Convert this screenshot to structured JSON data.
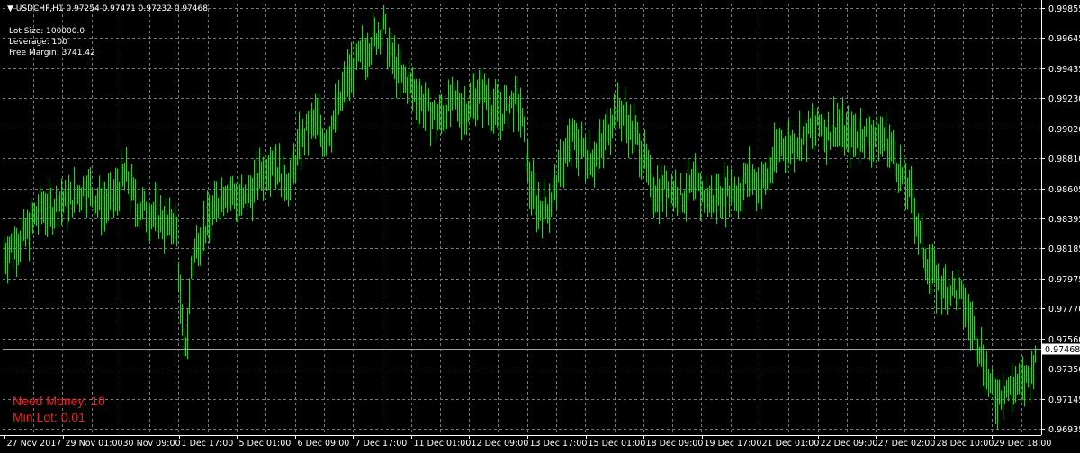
{
  "header": {
    "symbol": "USDCHF,H1",
    "ohlc": "0.97254 0.97471 0.97232 0.97468"
  },
  "account": {
    "lot_size": "Lot Size: 100000.0",
    "leverage": "Leverage: 100",
    "free_margin": "Free Margin: 3741.42"
  },
  "warnings": {
    "need_money": "Need Money: 10",
    "min_lot": "Min Lot: 0.01"
  },
  "colors": {
    "background": "#000000",
    "candle": "#3fbf3f",
    "grid": "#6e7a7a",
    "axis_text": "#ffffff",
    "warning": "#ff1a1a"
  },
  "chart_data": {
    "type": "bar",
    "symbol": "USDCHF",
    "timeframe": "H1",
    "grid": true,
    "ylim": [
      0.96905,
      0.99875
    ],
    "y_ticks": [
      "0.99855",
      "0.99645",
      "0.99435",
      "0.99230",
      "0.99020",
      "0.98810",
      "0.98605",
      "0.98395",
      "0.98185",
      "0.97975",
      "0.97770",
      "0.97560",
      "0.97350",
      "0.97145",
      "0.96935"
    ],
    "current_price": "0.97468",
    "x_ticks": [
      "27 Nov 2017",
      "29 Nov 01:00",
      "30 Nov 09:00",
      "1 Dec 17:00",
      "5 Dec 01:00",
      "6 Dec 09:00",
      "7 Dec 17:00",
      "11 Dec 01:00",
      "12 Dec 09:00",
      "13 Dec 17:00",
      "15 Dec 01:00",
      "18 Dec 09:00",
      "19 Dec 17:00",
      "21 Dec 01:00",
      "22 Dec 09:00",
      "27 Dec 02:00",
      "28 Dec 10:00",
      "29 Dec 18:00"
    ],
    "series": [
      {
        "values": [
          [
            0,
            0.981
          ],
          [
            10,
            0.9818
          ],
          [
            18,
            0.9822
          ],
          [
            28,
            0.9828
          ],
          [
            38,
            0.984
          ],
          [
            48,
            0.9848
          ],
          [
            55,
            0.9842
          ],
          [
            65,
            0.9852
          ],
          [
            75,
            0.985
          ],
          [
            86,
            0.9856
          ],
          [
            96,
            0.9862
          ],
          [
            106,
            0.9852
          ],
          [
            116,
            0.9848
          ],
          [
            126,
            0.9852
          ],
          [
            134,
            0.9865
          ],
          [
            140,
            0.987
          ],
          [
            146,
            0.9858
          ],
          [
            152,
            0.9848
          ],
          [
            160,
            0.9845
          ],
          [
            170,
            0.9842
          ],
          [
            180,
            0.9838
          ],
          [
            187,
            0.9832
          ],
          [
            192,
            0.9838
          ],
          [
            196,
            0.9828
          ],
          [
            200,
            0.9778
          ],
          [
            204,
            0.9745
          ],
          [
            208,
            0.976
          ],
          [
            212,
            0.9805
          ],
          [
            220,
            0.9825
          ],
          [
            230,
            0.9835
          ],
          [
            240,
            0.9848
          ],
          [
            250,
            0.986
          ],
          [
            260,
            0.9855
          ],
          [
            270,
            0.985
          ],
          [
            282,
            0.9862
          ],
          [
            292,
            0.9872
          ],
          [
            302,
            0.9882
          ],
          [
            312,
            0.987
          ],
          [
            322,
            0.9865
          ],
          [
            332,
            0.989
          ],
          [
            342,
            0.9902
          ],
          [
            352,
            0.9908
          ],
          [
            360,
            0.9895
          ],
          [
            368,
            0.9905
          ],
          [
            376,
            0.9918
          ],
          [
            384,
            0.9935
          ],
          [
            392,
            0.9945
          ],
          [
            400,
            0.9952
          ],
          [
            410,
            0.9962
          ],
          [
            418,
            0.9968
          ],
          [
            426,
            0.9975
          ],
          [
            430,
            0.9962
          ],
          [
            436,
            0.9952
          ],
          [
            444,
            0.9938
          ],
          [
            452,
            0.9935
          ],
          [
            460,
            0.9928
          ],
          [
            470,
            0.992
          ],
          [
            480,
            0.9912
          ],
          [
            488,
            0.991
          ],
          [
            496,
            0.9918
          ],
          [
            506,
            0.992
          ],
          [
            516,
            0.9915
          ],
          [
            524,
            0.9922
          ],
          [
            532,
            0.9928
          ],
          [
            540,
            0.9925
          ],
          [
            548,
            0.9915
          ],
          [
            556,
            0.9912
          ],
          [
            564,
            0.9918
          ],
          [
            572,
            0.9922
          ],
          [
            578,
            0.9915
          ],
          [
            582,
            0.9895
          ],
          [
            588,
            0.9865
          ],
          [
            596,
            0.9848
          ],
          [
            604,
            0.9845
          ],
          [
            612,
            0.9852
          ],
          [
            620,
            0.9868
          ],
          [
            628,
            0.9885
          ],
          [
            636,
            0.9895
          ],
          [
            644,
            0.989
          ],
          [
            652,
            0.9885
          ],
          [
            660,
            0.9882
          ],
          [
            668,
            0.9888
          ],
          [
            676,
            0.9905
          ],
          [
            684,
            0.9915
          ],
          [
            692,
            0.9912
          ],
          [
            700,
            0.9902
          ],
          [
            708,
            0.9895
          ],
          [
            716,
            0.988
          ],
          [
            722,
            0.9862
          ],
          [
            730,
            0.9858
          ],
          [
            740,
            0.9862
          ],
          [
            750,
            0.9858
          ],
          [
            758,
            0.9855
          ],
          [
            766,
            0.986
          ],
          [
            774,
            0.9862
          ],
          [
            782,
            0.9855
          ],
          [
            790,
            0.9852
          ],
          [
            798,
            0.9856
          ],
          [
            806,
            0.9858
          ],
          [
            814,
            0.986
          ],
          [
            820,
            0.9855
          ],
          [
            826,
            0.9865
          ],
          [
            834,
            0.9868
          ],
          [
            842,
            0.9862
          ],
          [
            850,
            0.9865
          ],
          [
            858,
            0.9878
          ],
          [
            866,
            0.9892
          ],
          [
            874,
            0.989
          ],
          [
            882,
            0.9892
          ],
          [
            890,
            0.9895
          ],
          [
            898,
            0.99
          ],
          [
            906,
            0.9902
          ],
          [
            912,
            0.9905
          ],
          [
            918,
            0.9898
          ],
          [
            924,
            0.9902
          ],
          [
            930,
            0.9905
          ],
          [
            936,
            0.99
          ],
          [
            944,
            0.9895
          ],
          [
            952,
            0.9898
          ],
          [
            960,
            0.99
          ],
          [
            968,
            0.9896
          ],
          [
            976,
            0.9898
          ],
          [
            984,
            0.9895
          ],
          [
            990,
            0.9888
          ],
          [
            996,
            0.9878
          ],
          [
            1002,
            0.9868
          ],
          [
            1008,
            0.986
          ],
          [
            1014,
            0.985
          ],
          [
            1020,
            0.983
          ],
          [
            1026,
            0.9815
          ],
          [
            1032,
            0.9805
          ],
          [
            1040,
            0.9795
          ],
          [
            1048,
            0.9788
          ],
          [
            1056,
            0.979
          ],
          [
            1064,
            0.9785
          ],
          [
            1072,
            0.9778
          ],
          [
            1078,
            0.9765
          ],
          [
            1084,
            0.9755
          ],
          [
            1090,
            0.9745
          ],
          [
            1096,
            0.973
          ],
          [
            1100,
            0.972
          ],
          [
            1104,
            0.9712
          ],
          [
            1110,
            0.9715
          ],
          [
            1116,
            0.972
          ],
          [
            1122,
            0.9718
          ],
          [
            1128,
            0.9722
          ],
          [
            1134,
            0.972
          ],
          [
            1140,
            0.9725
          ],
          [
            1146,
            0.973
          ],
          [
            1150,
            0.97468
          ]
        ]
      }
    ]
  }
}
